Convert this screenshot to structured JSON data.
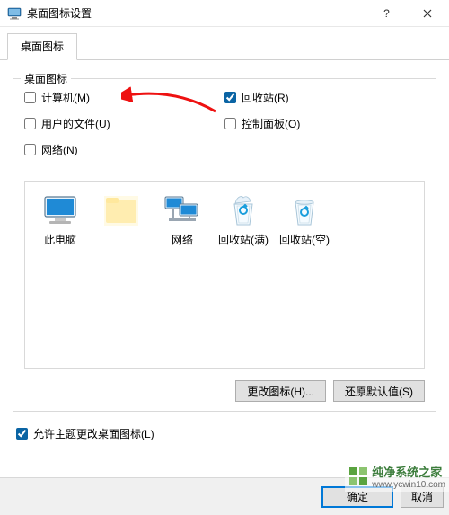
{
  "window": {
    "title": "桌面图标设置"
  },
  "tab": {
    "label": "桌面图标"
  },
  "group": {
    "title": "桌面图标",
    "items": {
      "computer": {
        "label": "计算机(M)",
        "checked": false
      },
      "recycle": {
        "label": "回收站(R)",
        "checked": true
      },
      "userfiles": {
        "label": "用户的文件(U)",
        "checked": false
      },
      "cpanel": {
        "label": "控制面板(O)",
        "checked": false
      },
      "network": {
        "label": "网络(N)",
        "checked": false
      }
    }
  },
  "iconlist": {
    "pc": "此电脑",
    "blank": "",
    "network": "网络",
    "binfull": "回收站(满)",
    "binempty": "回收站(空)"
  },
  "buttons": {
    "changeIcon": "更改图标(H)...",
    "restore": "还原默认值(S)",
    "ok": "确定",
    "cancel": "取消"
  },
  "allowThemes": {
    "label": "允许主题更改桌面图标(L)",
    "checked": true
  },
  "watermark": {
    "name": "纯净系统之家",
    "url": "www.ycwin10.com"
  }
}
